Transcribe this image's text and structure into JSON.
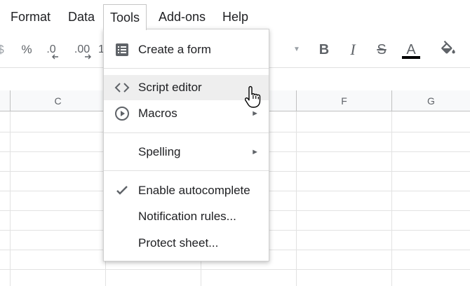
{
  "menubar": {
    "items": [
      {
        "label": "Format"
      },
      {
        "label": "Data"
      },
      {
        "label": "Tools"
      },
      {
        "label": "Add-ons"
      },
      {
        "label": "Help"
      }
    ],
    "open_menu": "Tools"
  },
  "toolbar": {
    "percent": "%",
    "decimal_decrease": ".0",
    "decimal_increase": ".00",
    "more_formats": "1",
    "bold": "B",
    "italic": "I",
    "strikethrough": "S",
    "text_color": "A",
    "text_color_value": "#000000"
  },
  "grid": {
    "columns": [
      "C",
      "F",
      "G"
    ]
  },
  "tools_menu": {
    "items": [
      {
        "label": "Create a form",
        "icon": "form-icon"
      },
      {
        "label": "Script editor",
        "icon": "code-icon",
        "highlighted": true
      },
      {
        "label": "Macros",
        "icon": "play-circle-icon",
        "submenu": "►"
      },
      {
        "label": "Spelling",
        "submenu": "►"
      },
      {
        "label": "Enable autocomplete",
        "icon": "checkmark-icon",
        "checked": true
      },
      {
        "label": "Notification rules..."
      },
      {
        "label": "Protect sheet..."
      }
    ]
  },
  "colors": {
    "hover_bg": "#eeeeee",
    "icon_gray": "#5f6368",
    "header_bg": "#f8f9fa"
  }
}
